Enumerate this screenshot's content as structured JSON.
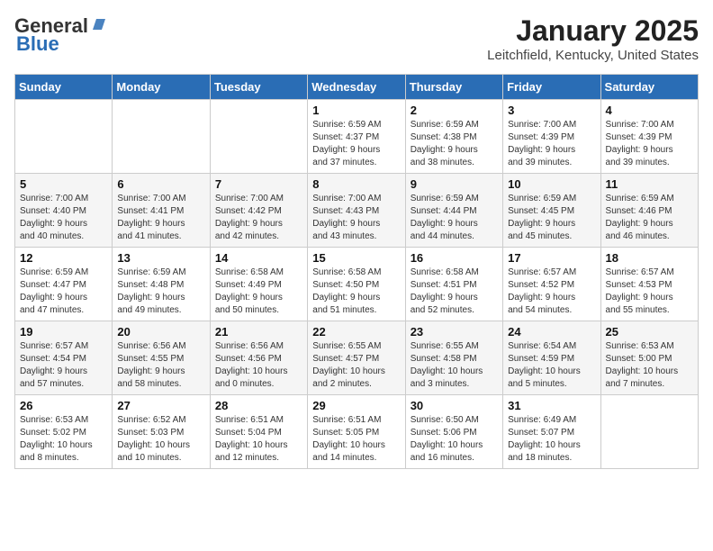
{
  "header": {
    "logo_general": "General",
    "logo_blue": "Blue",
    "month_title": "January 2025",
    "location": "Leitchfield, Kentucky, United States"
  },
  "weekdays": [
    "Sunday",
    "Monday",
    "Tuesday",
    "Wednesday",
    "Thursday",
    "Friday",
    "Saturday"
  ],
  "weeks": [
    [
      {
        "day": "",
        "info": ""
      },
      {
        "day": "",
        "info": ""
      },
      {
        "day": "",
        "info": ""
      },
      {
        "day": "1",
        "info": "Sunrise: 6:59 AM\nSunset: 4:37 PM\nDaylight: 9 hours\nand 37 minutes."
      },
      {
        "day": "2",
        "info": "Sunrise: 6:59 AM\nSunset: 4:38 PM\nDaylight: 9 hours\nand 38 minutes."
      },
      {
        "day": "3",
        "info": "Sunrise: 7:00 AM\nSunset: 4:39 PM\nDaylight: 9 hours\nand 39 minutes."
      },
      {
        "day": "4",
        "info": "Sunrise: 7:00 AM\nSunset: 4:39 PM\nDaylight: 9 hours\nand 39 minutes."
      }
    ],
    [
      {
        "day": "5",
        "info": "Sunrise: 7:00 AM\nSunset: 4:40 PM\nDaylight: 9 hours\nand 40 minutes."
      },
      {
        "day": "6",
        "info": "Sunrise: 7:00 AM\nSunset: 4:41 PM\nDaylight: 9 hours\nand 41 minutes."
      },
      {
        "day": "7",
        "info": "Sunrise: 7:00 AM\nSunset: 4:42 PM\nDaylight: 9 hours\nand 42 minutes."
      },
      {
        "day": "8",
        "info": "Sunrise: 7:00 AM\nSunset: 4:43 PM\nDaylight: 9 hours\nand 43 minutes."
      },
      {
        "day": "9",
        "info": "Sunrise: 6:59 AM\nSunset: 4:44 PM\nDaylight: 9 hours\nand 44 minutes."
      },
      {
        "day": "10",
        "info": "Sunrise: 6:59 AM\nSunset: 4:45 PM\nDaylight: 9 hours\nand 45 minutes."
      },
      {
        "day": "11",
        "info": "Sunrise: 6:59 AM\nSunset: 4:46 PM\nDaylight: 9 hours\nand 46 minutes."
      }
    ],
    [
      {
        "day": "12",
        "info": "Sunrise: 6:59 AM\nSunset: 4:47 PM\nDaylight: 9 hours\nand 47 minutes."
      },
      {
        "day": "13",
        "info": "Sunrise: 6:59 AM\nSunset: 4:48 PM\nDaylight: 9 hours\nand 49 minutes."
      },
      {
        "day": "14",
        "info": "Sunrise: 6:58 AM\nSunset: 4:49 PM\nDaylight: 9 hours\nand 50 minutes."
      },
      {
        "day": "15",
        "info": "Sunrise: 6:58 AM\nSunset: 4:50 PM\nDaylight: 9 hours\nand 51 minutes."
      },
      {
        "day": "16",
        "info": "Sunrise: 6:58 AM\nSunset: 4:51 PM\nDaylight: 9 hours\nand 52 minutes."
      },
      {
        "day": "17",
        "info": "Sunrise: 6:57 AM\nSunset: 4:52 PM\nDaylight: 9 hours\nand 54 minutes."
      },
      {
        "day": "18",
        "info": "Sunrise: 6:57 AM\nSunset: 4:53 PM\nDaylight: 9 hours\nand 55 minutes."
      }
    ],
    [
      {
        "day": "19",
        "info": "Sunrise: 6:57 AM\nSunset: 4:54 PM\nDaylight: 9 hours\nand 57 minutes."
      },
      {
        "day": "20",
        "info": "Sunrise: 6:56 AM\nSunset: 4:55 PM\nDaylight: 9 hours\nand 58 minutes."
      },
      {
        "day": "21",
        "info": "Sunrise: 6:56 AM\nSunset: 4:56 PM\nDaylight: 10 hours\nand 0 minutes."
      },
      {
        "day": "22",
        "info": "Sunrise: 6:55 AM\nSunset: 4:57 PM\nDaylight: 10 hours\nand 2 minutes."
      },
      {
        "day": "23",
        "info": "Sunrise: 6:55 AM\nSunset: 4:58 PM\nDaylight: 10 hours\nand 3 minutes."
      },
      {
        "day": "24",
        "info": "Sunrise: 6:54 AM\nSunset: 4:59 PM\nDaylight: 10 hours\nand 5 minutes."
      },
      {
        "day": "25",
        "info": "Sunrise: 6:53 AM\nSunset: 5:00 PM\nDaylight: 10 hours\nand 7 minutes."
      }
    ],
    [
      {
        "day": "26",
        "info": "Sunrise: 6:53 AM\nSunset: 5:02 PM\nDaylight: 10 hours\nand 8 minutes."
      },
      {
        "day": "27",
        "info": "Sunrise: 6:52 AM\nSunset: 5:03 PM\nDaylight: 10 hours\nand 10 minutes."
      },
      {
        "day": "28",
        "info": "Sunrise: 6:51 AM\nSunset: 5:04 PM\nDaylight: 10 hours\nand 12 minutes."
      },
      {
        "day": "29",
        "info": "Sunrise: 6:51 AM\nSunset: 5:05 PM\nDaylight: 10 hours\nand 14 minutes."
      },
      {
        "day": "30",
        "info": "Sunrise: 6:50 AM\nSunset: 5:06 PM\nDaylight: 10 hours\nand 16 minutes."
      },
      {
        "day": "31",
        "info": "Sunrise: 6:49 AM\nSunset: 5:07 PM\nDaylight: 10 hours\nand 18 minutes."
      },
      {
        "day": "",
        "info": ""
      }
    ]
  ]
}
